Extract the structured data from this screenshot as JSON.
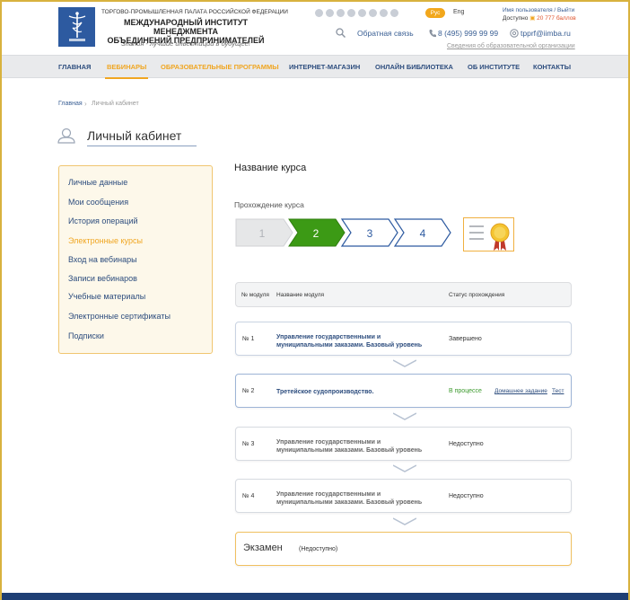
{
  "header": {
    "org_top": "ТОРГОВО-ПРОМЫШЛЕННАЯ ПАЛАТА РОССИЙСКОЙ ФЕДЕРАЦИИ",
    "org_name_line1": "МЕЖДУНАРОДНЫЙ ИНСТИТУТ МЕНЕДЖМЕНТА",
    "org_name_line2": "ОБЪЕДИНЕНИЙ ПРЕДПРИНИМАТЕЛЕЙ",
    "slogan": "Знания - лучшие инвестиции в будущее!",
    "lang_active": "Рус",
    "lang_other": "Eng",
    "user_line1": "Имя пользователя / Выйти",
    "user_available": "Доступно",
    "user_points": "20 777 баллов",
    "feedback": "Обратная связь",
    "phone": "8 (495) 999 99 99",
    "email": "tpprf@iimba.ru",
    "edu_info": "Сведения об образовательной организации",
    "social_icons": [
      "facebook-icon",
      "twitter-icon",
      "vk-icon",
      "odnoklassniki-icon",
      "google-plus-icon",
      "linkedin-icon",
      "youtube-icon",
      "instagram-icon"
    ]
  },
  "nav": {
    "items": [
      {
        "label": "ГЛАВНАЯ"
      },
      {
        "label": "ВЕБИНАРЫ"
      },
      {
        "label": "ОБРАЗОВАТЕЛЬНЫЕ ПРОГРАММЫ"
      },
      {
        "label": "ИНТЕРНЕТ-МАГАЗИН"
      },
      {
        "label": "ОНЛАЙН БИБЛИОТЕКА"
      },
      {
        "label": "ОБ ИНСТИТУТЕ"
      },
      {
        "label": "КОНТАКТЫ"
      }
    ]
  },
  "breadcrumb": {
    "home": "Главная",
    "current": "Личный кабинет"
  },
  "page_title": "Личный кабинет",
  "sidebar": {
    "items": [
      {
        "label": "Личные данные"
      },
      {
        "label": "Мои сообщения"
      },
      {
        "label": "История операций"
      },
      {
        "label": "Электронные курсы"
      },
      {
        "label": "Вход на вебинары"
      },
      {
        "label": "Записи вебинаров"
      },
      {
        "label": "Учебные материалы"
      },
      {
        "label": "Электронные сертификаты"
      },
      {
        "label": "Подписки"
      }
    ],
    "active_index": 3
  },
  "course": {
    "title": "Название курса",
    "progress_label": "Прохождение курса",
    "steps": [
      "1",
      "2",
      "3",
      "4"
    ],
    "current_step": 2,
    "colors": {
      "done": "#e6e7e8",
      "current": "#3c9a15",
      "pending": "#2d5aa0",
      "accent": "#f0a622"
    }
  },
  "table": {
    "headers": {
      "num": "№ модуля",
      "name": "Название модуля",
      "status": "Статус прохождения"
    },
    "rows": [
      {
        "num": "№ 1",
        "name_line1": "Управление государственными и",
        "name_line2": "муниципальными заказами. Базовый уровень",
        "status": "Завершено"
      },
      {
        "num": "№ 2",
        "name_line1": "Третейское судопроизводство.",
        "status": "В процессе",
        "homework": "Домашнее задание",
        "test": "Тест"
      },
      {
        "num": "№ 3",
        "name_line1": "Управление государственными и",
        "name_line2": "муниципальными заказами. Базовый уровень",
        "status": "Недоступно"
      },
      {
        "num": "№ 4",
        "name_line1": "Управление государственными и",
        "name_line2": "муниципальными заказами. Базовый уровень",
        "status": "Недоступно"
      }
    ]
  },
  "exam": {
    "title": "Экзамен",
    "status": "(Недоступно)"
  }
}
